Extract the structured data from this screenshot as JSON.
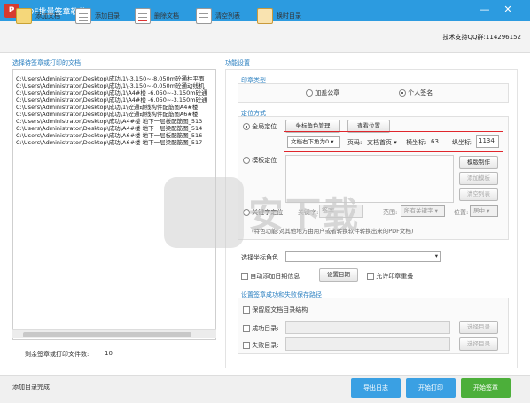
{
  "window": {
    "title": "PDF批量签章软件",
    "app_icon": "P"
  },
  "toolbar": {
    "add_file": "添加文档",
    "add_dir": "添加目录",
    "delete_file": "删除文档",
    "clear_list": "清空列表",
    "add_dir2": "换时目录",
    "support": "技术支持QQ群:114296152"
  },
  "left": {
    "title": "选择待签章或打印的文档",
    "files": [
      "C:\\Users\\Administrator\\Desktop\\成功\\1\\-3.150~-8.050m砼通柱平面",
      "C:\\Users\\Administrator\\Desktop\\成功\\1\\-3.150~-0.050m砼通动线机",
      "C:\\Users\\Administrator\\Desktop\\成功\\1\\A4#楼 -6.050~-3.150m砼通",
      "C:\\Users\\Administrator\\Desktop\\成功\\1\\A4#楼 -6.050~-3.150m砼通",
      "C:\\Users\\Administrator\\Desktop\\成功\\1\\砼通动线构件配筋图A4#楼",
      "C:\\Users\\Administrator\\Desktop\\成功\\1\\砼通动线构件配筋图A6#楼",
      "C:\\Users\\Administrator\\Desktop\\成功\\A4#楼 地下一层板配筋图_513",
      "C:\\Users\\Administrator\\Desktop\\成功\\A4#楼 地下一层梁配筋图_514",
      "C:\\Users\\Administrator\\Desktop\\成功\\A6#楼 地下一层板配筋图_516",
      "C:\\Users\\Administrator\\Desktop\\成功\\A6#楼 地下一层梁配筋图_517"
    ],
    "remaining_label": "剩余签章或打印文件数:",
    "remaining_count": "10"
  },
  "right": {
    "title": "功能设置",
    "stamp_type": {
      "title": "印章类型",
      "opt1": "加盖公章",
      "opt2": "个人签名"
    },
    "position": {
      "title": "定位方式",
      "full_pos": "全局定位",
      "manage_coord": "坐标角色管理",
      "view_pos": "查看位置",
      "anchor_select": "文档右下角为0",
      "page_label": "页码:",
      "page_select": "文档首页",
      "x_label": "横坐标:",
      "x_value": "63",
      "y_label": "纵坐标:",
      "y_value": "1134",
      "template_pos": "模板定位",
      "template_make": "模版制作",
      "template_add": "添加模板",
      "template_clear": "清空列表",
      "keyword_pos": "关键字定位",
      "keyword_label": "关键字:",
      "keyword_value": "签字",
      "range_label": "范围:",
      "range_value": "所有关键字",
      "place_label": "位置:",
      "place_value": "居中",
      "note": "(特色功能:对其他地方由用户或者转换软件转换出来的PDF文档)"
    },
    "coord_role_label": "选择坐标角色",
    "auto_date": "自动添加日期信息",
    "set_date": "设置日期",
    "allow_overlap": "允许印章重叠",
    "save": {
      "title": "设置签章成功和失败保存路径",
      "keep_structure": "保留原文档目录结构",
      "success_label": "成功目录:",
      "fail_label": "失败目录:",
      "choose": "选择目录"
    }
  },
  "status": {
    "text": "添加目录完成",
    "export_log": "导出日志",
    "start_print": "开始打印",
    "start_sign": "开始签章"
  },
  "watermark": {
    "text": "安下载"
  },
  "colors": {
    "titlebar": "#2c9be0",
    "export_btn": "#3aa0e3",
    "sign_btn": "#4caf3a",
    "highlight": "#e0262c"
  }
}
